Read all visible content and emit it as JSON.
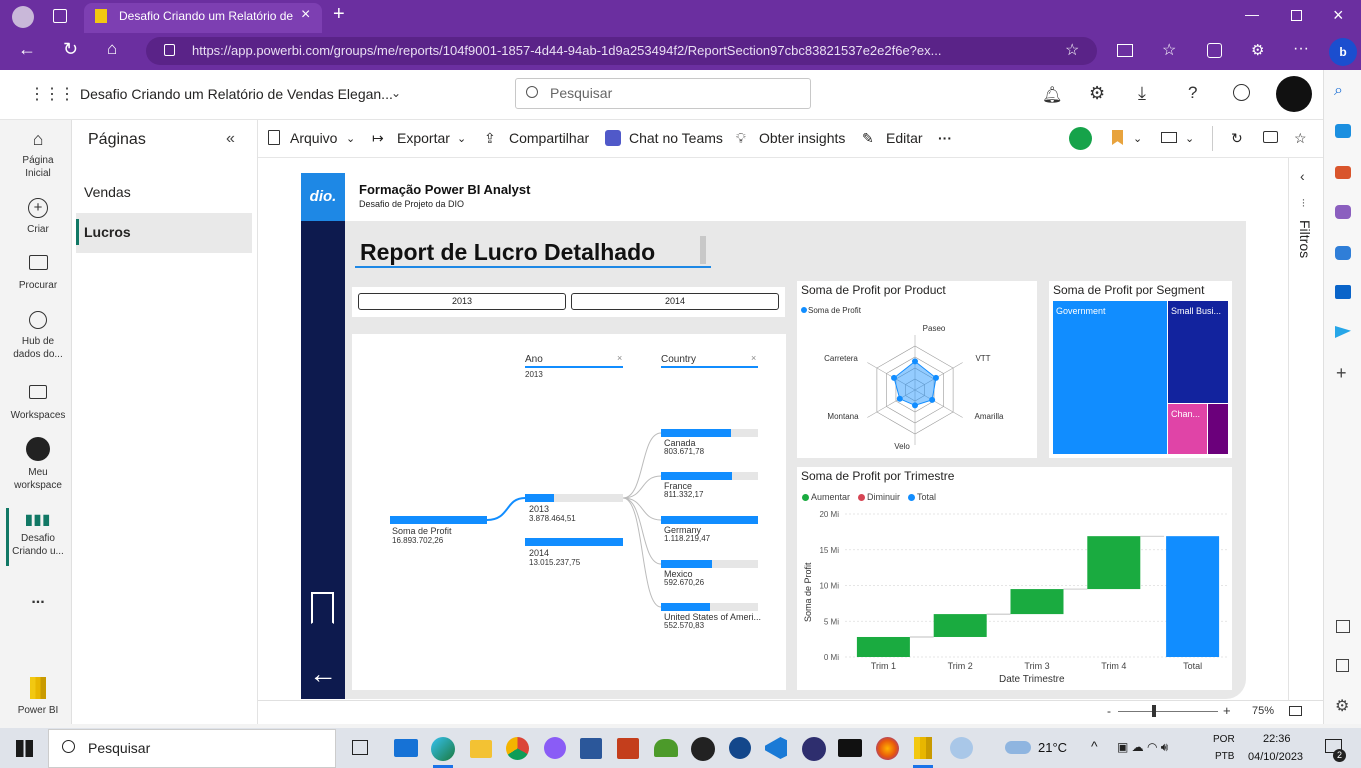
{
  "browser": {
    "tab_title": "Desafio Criando um Relatório de",
    "url": "https://app.powerbi.com/groups/me/reports/104f9001-1857-4d44-94ab-1d9a253494f2/ReportSection97cbc83821537e2e2f6e?ex..."
  },
  "header": {
    "report_title": "Desafio Criando um Relatório de Vendas Elegan...",
    "search_placeholder": "Pesquisar"
  },
  "leftnav": [
    {
      "label": "Página Inicial"
    },
    {
      "label": "Criar"
    },
    {
      "label": "Procurar"
    },
    {
      "label": "Hub de dados do..."
    },
    {
      "label": "Workspaces"
    },
    {
      "label": "Meu workspace"
    },
    {
      "label": "Desafio Criando u..."
    },
    {
      "label": "..."
    },
    {
      "label": "Power BI"
    }
  ],
  "pages": {
    "title": "Páginas",
    "items": [
      "Vendas",
      "Lucros"
    ]
  },
  "toolbar": {
    "arquivo": "Arquivo",
    "exportar": "Exportar",
    "compartilhar": "Compartilhar",
    "chat": "Chat no Teams",
    "insights": "Obter insights",
    "editar": "Editar",
    "more": "···"
  },
  "filters_label": "Filtros",
  "report": {
    "brand": "dio.",
    "title": "Formação Power BI Analyst",
    "subtitle": "Desafio de Projeto da DIO",
    "heading": "Report de Lucro Detalhado",
    "slicer": [
      "2013",
      "2014"
    ]
  },
  "tree": {
    "ano_label": "Ano",
    "ano_value": "2013",
    "country_label": "Country",
    "root_label": "Soma de Profit",
    "root_value": "16.893.702,26",
    "years": [
      {
        "label": "2013",
        "value": "3.878.464,51",
        "frac": 0.3
      },
      {
        "label": "2014",
        "value": "13.015.237,75",
        "frac": 1.0
      }
    ],
    "countries": [
      {
        "label": "Canada",
        "value": "803.671,78",
        "frac": 0.72
      },
      {
        "label": "France",
        "value": "811.332,17",
        "frac": 0.73
      },
      {
        "label": "Germany",
        "value": "1.118.219,47",
        "frac": 1.0
      },
      {
        "label": "Mexico",
        "value": "592.670,26",
        "frac": 0.53
      },
      {
        "label": "United States of Ameri...",
        "value": "552.570,83",
        "frac": 0.5
      }
    ]
  },
  "chart_data": [
    {
      "type": "radar",
      "title": "Soma de Profit por Product",
      "legend": "Soma de Profit",
      "axes": [
        "Paseo",
        "VTT",
        "Amarilla",
        "Velo",
        "Montana",
        "Carretera"
      ]
    },
    {
      "type": "treemap",
      "title": "Soma de Profit por Segment",
      "items": [
        {
          "label": "Government",
          "color": "#118DFF"
        },
        {
          "label": "Small Busi...",
          "color": "#12239E"
        },
        {
          "label": "Chan...",
          "color": "#E044A7"
        },
        {
          "label": "",
          "color": "#6B007B"
        }
      ]
    },
    {
      "type": "waterfall",
      "title": "Soma de Profit por Trimestre",
      "legend": [
        "Aumentar",
        "Diminuir",
        "Total"
      ],
      "colors": {
        "increase": "#1AAB40",
        "decrease": "#D64554",
        "total": "#118DFF"
      },
      "categories": [
        "Trim 1",
        "Trim 2",
        "Trim 3",
        "Trim 4",
        "Total"
      ],
      "values": [
        2.8,
        3.2,
        3.5,
        7.4,
        16.9
      ],
      "ylim": [
        0,
        20
      ],
      "yticks": [
        "0 Mi",
        "5 Mi",
        "10 Mi",
        "15 Mi",
        "20 Mi"
      ],
      "xlabel": "Date Trimestre",
      "ylabel": "Soma de Profit"
    }
  ],
  "status": {
    "zoom": "75%"
  },
  "taskbar": {
    "search": "Pesquisar",
    "weather": "21°C",
    "lang1": "POR",
    "lang2": "PTB",
    "time": "22:36",
    "date": "04/10/2023",
    "notif": "2"
  }
}
